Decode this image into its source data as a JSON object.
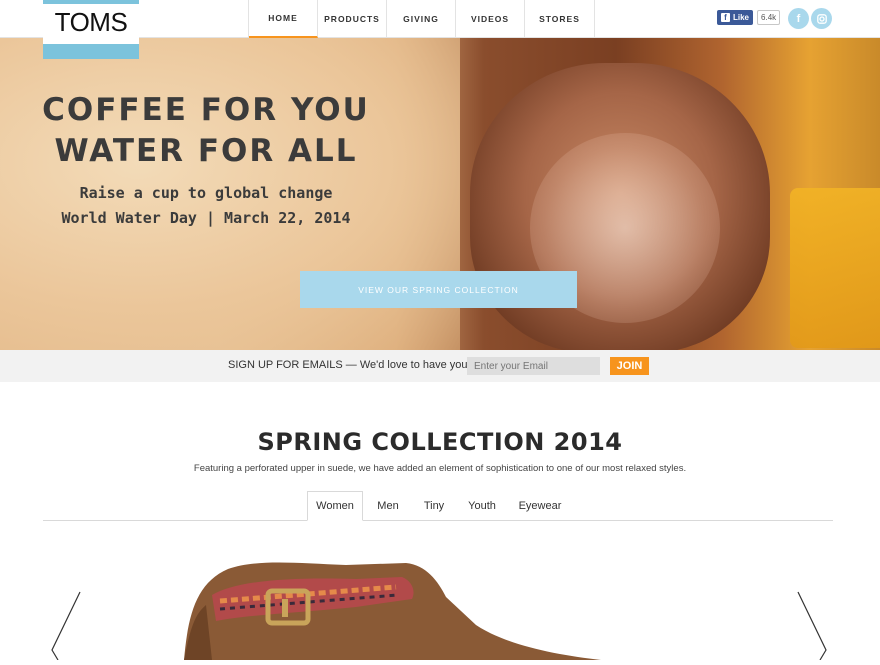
{
  "header": {
    "logo_text": "TOMS",
    "nav": [
      {
        "label": "HOME",
        "active": true
      },
      {
        "label": "PRODUCTS",
        "active": false
      },
      {
        "label": "GIVING",
        "active": false
      },
      {
        "label": "VIDEOS",
        "active": false
      },
      {
        "label": "STORES",
        "active": false
      }
    ],
    "fb_like_label": "Like",
    "fb_like_count": "6.4k",
    "social_icons": [
      "facebook-icon",
      "instagram-icon"
    ]
  },
  "hero": {
    "title_line1": "COFFEE FOR YOU",
    "title_line2": "WATER FOR ALL",
    "subtitle_line1": "Raise a cup to global change",
    "subtitle_line2": "World Water Day | March 22, 2014",
    "cta_label": "VIEW OUR SPRING COLLECTION"
  },
  "signup": {
    "lead": "SIGN UP FOR EMAILS",
    "text": " — We'd love to have you!",
    "placeholder": "Enter your Email",
    "button_label": "JOIN"
  },
  "collection": {
    "title": "SPRING COLLECTION 2014",
    "description": "Featuring a perforated upper in suede, we have added an element of sophistication to one of our most relaxed styles.",
    "tabs": [
      {
        "label": "Women",
        "active": true
      },
      {
        "label": "Men",
        "active": false
      },
      {
        "label": "Tiny",
        "active": false
      },
      {
        "label": "Youth",
        "active": false
      },
      {
        "label": "Eyewear",
        "active": false
      }
    ]
  },
  "colors": {
    "accent_orange": "#f7941d",
    "accent_blue": "#a9d8ec",
    "logo_blue": "#7cc3dc"
  }
}
